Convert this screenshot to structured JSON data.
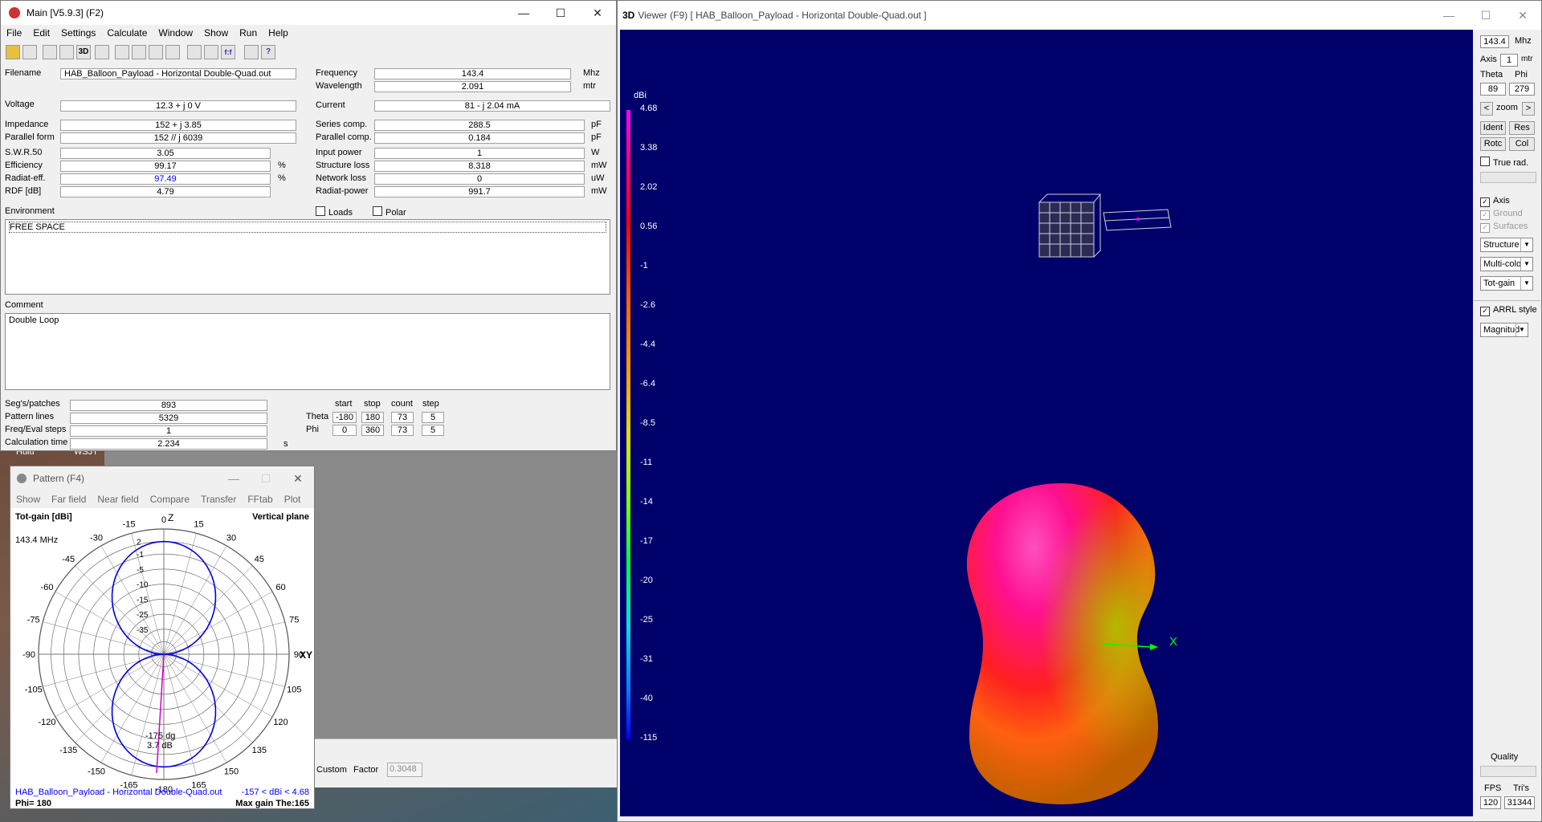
{
  "main": {
    "title": "Main [V5.9.3]  (F2)",
    "menu": [
      "File",
      "Edit",
      "Settings",
      "Calculate",
      "Window",
      "Show",
      "Run",
      "Help"
    ],
    "fields": {
      "filename_label": "Filename",
      "filename": "HAB_Balloon_Payload - Horizontal Double-Quad.out",
      "voltage_label": "Voltage",
      "voltage": "12.3 + j 0 V",
      "impedance_label": "Impedance",
      "impedance": "152 + j 3.85",
      "parallel_label": "Parallel form",
      "parallel": "152 // j 6039",
      "swr_label": "S.W.R.50",
      "swr": "3.05",
      "eff_label": "Efficiency",
      "eff": "99.17",
      "radeff_label": "Radiat-eff.",
      "radeff": "97.49",
      "rdf_label": "RDF [dB]",
      "rdf": "4.79",
      "freq_label": "Frequency",
      "freq": "143.4",
      "freq_unit": "Mhz",
      "wave_label": "Wavelength",
      "wave": "2.091",
      "wave_unit": "mtr",
      "current_label": "Current",
      "current": "81 - j 2.04 mA",
      "series_label": "Series comp.",
      "series": "288.5",
      "series_unit": "pF",
      "pcomp_label": "Parallel comp.",
      "pcomp": "0.184",
      "pcomp_unit": "pF",
      "inpow_label": "Input power",
      "inpow": "1",
      "inpow_unit": "W",
      "sloss_label": "Structure loss",
      "sloss": "8.318",
      "sloss_unit": "mW",
      "nloss_label": "Network loss",
      "nloss": "0",
      "nloss_unit": "uW",
      "rpow_label": "Radiat-power",
      "rpow": "991.7",
      "rpow_unit": "mW",
      "pct": "%"
    },
    "loads_label": "Loads",
    "polar_label": "Polar",
    "environment_label": "Environment",
    "environment": "FREE SPACE",
    "comment_label": "Comment",
    "comment": "Double Loop",
    "stats": {
      "segs_label": "Seg's/patches",
      "segs": "893",
      "lines_label": "Pattern lines",
      "lines": "5329",
      "freqsteps_label": "Freq/Eval steps",
      "freqsteps": "1",
      "calc_label": "Calculation time",
      "calc": "2.234",
      "calc_unit": "s"
    },
    "sweep": {
      "headers": [
        "start",
        "stop",
        "count",
        "step"
      ],
      "theta_label": "Theta",
      "theta": [
        "-180",
        "180",
        "73",
        "5"
      ],
      "phi_label": "Phi",
      "phi": [
        "0",
        "360",
        "73",
        "5"
      ]
    }
  },
  "pattern": {
    "title": "Pattern   (F4)",
    "menu": [
      "Show",
      "Far field",
      "Near field",
      "Compare",
      "Transfer",
      "FFtab",
      "Plot"
    ],
    "tl": "Tot-gain [dBi]",
    "tr": "Vertical plane",
    "freq": "143.4 MHz",
    "z": "Z",
    "xy": "XY",
    "angles": [
      "0",
      "15",
      "30",
      "45",
      "60",
      "75",
      "90",
      "105",
      "120",
      "135",
      "150",
      "165",
      "-180",
      "-165",
      "-150",
      "-135",
      "-120",
      "-105",
      "-90",
      "-75",
      "-60",
      "-45",
      "-30",
      "-15"
    ],
    "rings": [
      "2",
      "-1",
      "-5",
      "-10",
      "-15",
      "-25",
      "-35"
    ],
    "marker1": "-175 dg",
    "marker2": "3.7 dB",
    "bl_file": "HAB_Balloon_Payload - Horizontal Double-Quad.out",
    "br_range": "-157 < dBi < 4.68",
    "bl_phi": "Phi= 180",
    "br_max": "Max gain The:165"
  },
  "taskbar": {
    "hulu": "Hulu",
    "wsj": "WSJT"
  },
  "misc": {
    "custom": "Custom",
    "factor_label": "Factor",
    "factor": "0.3048"
  },
  "viewer": {
    "title_prefix": "3D",
    "title": "Viewer (F9)    [  HAB_Balloon_Payload - Horizontal Double-Quad.out  ]",
    "unit": "dBi",
    "scale": [
      "4.68",
      "3.38",
      "2.02",
      "0.56",
      "-1",
      "-2.6",
      "-4.4",
      "-6.4",
      "-8.5",
      "-11",
      "-14",
      "-17",
      "-20",
      "-25",
      "-31",
      "-40",
      "-115"
    ],
    "x_axis": "X",
    "panel": {
      "freq": "143.4",
      "freq_unit": "Mhz",
      "axis_label": "Axis",
      "axis": "1",
      "axis_unit": "mtr",
      "theta_label": "Theta",
      "phi_label": "Phi",
      "theta": "89",
      "phi": "279",
      "zoom": "zoom",
      "ident": "Ident",
      "res": "Res",
      "rotc": "Rotc",
      "col": "Col",
      "true_rad": "True rad.",
      "axis_chk": "Axis",
      "ground_chk": "Ground",
      "surfaces_chk": "Surfaces",
      "sel1": "Structure",
      "sel2": "Multi-colo",
      "sel3": "Tot-gain",
      "arrl": "ARRL style",
      "sel4": "Magnitud",
      "quality": "Quality",
      "fps_label": "FPS",
      "tris_label": "Tri's",
      "fps": "120",
      "tris": "31344"
    }
  },
  "colors": {
    "viewer_bg": "#00006b",
    "pattern_line": "#0000e0",
    "marker": "#d000d0",
    "link_blue": "#0000ff"
  }
}
